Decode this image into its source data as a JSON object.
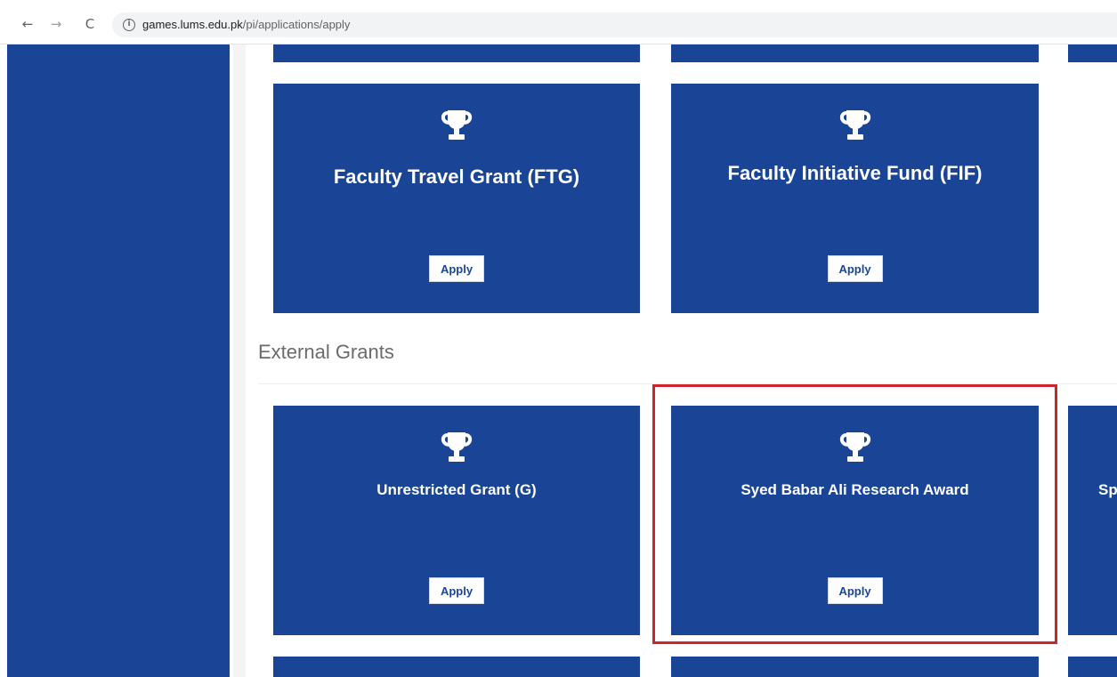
{
  "browser": {
    "back_icon": "←",
    "forward_icon": "→",
    "reload_icon": "C",
    "url_host": "games.lums.edu.pk",
    "url_path": "/pi/applications/apply"
  },
  "internal_cards": [
    {
      "title": "Faculty Travel Grant (FTG)",
      "apply_label": "Apply"
    },
    {
      "title": "Faculty Initiative Fund (FIF)",
      "apply_label": "Apply"
    }
  ],
  "external_section": {
    "title": "External Grants"
  },
  "external_cards": [
    {
      "title": "Unrestricted Grant (G)",
      "apply_label": "Apply"
    },
    {
      "title": "Syed Babar Ali Research Award",
      "apply_label": "Apply"
    },
    {
      "title": "Sp"
    }
  ],
  "colors": {
    "brand_blue": "#1a4597",
    "highlight_red": "#d0232b"
  }
}
